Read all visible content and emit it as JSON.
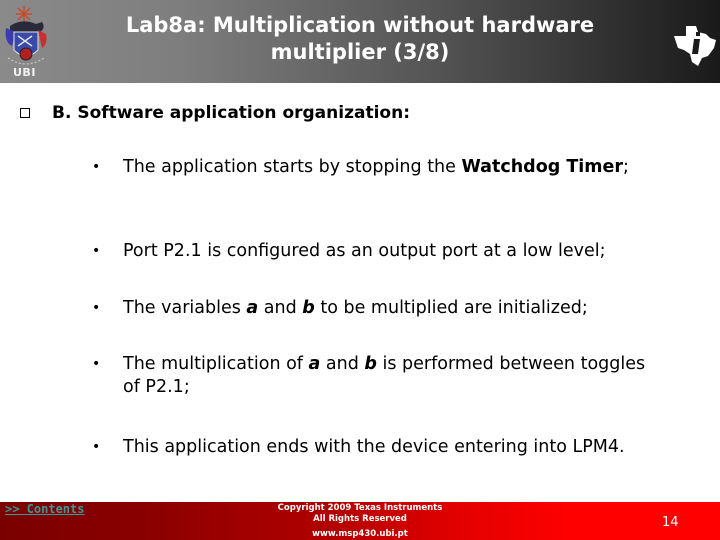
{
  "header": {
    "title_line1": "Lab8a: Multiplication without hardware",
    "title_line2": "multiplier (3/8)",
    "left_logo_text": "UBI",
    "left_logo_icon": "ubi-coat-of-arms-icon",
    "right_logo_icon": "texas-instruments-logo-icon"
  },
  "section": {
    "marker_icon": "hollow-square-bullet-icon",
    "heading": "B. Software application organization:"
  },
  "bullets": [
    {
      "parts": [
        {
          "text": "The application starts by stopping the ",
          "style": "normal"
        },
        {
          "text": "Watchdog Timer",
          "style": "bold"
        },
        {
          "text": ";",
          "style": "normal"
        }
      ]
    },
    {
      "parts": [
        {
          "text": "Port P2.1 is configured as an output port at a low level;",
          "style": "normal"
        }
      ]
    },
    {
      "parts": [
        {
          "text": "The variables ",
          "style": "normal"
        },
        {
          "text": "a",
          "style": "bold-italic"
        },
        {
          "text": " and ",
          "style": "normal"
        },
        {
          "text": "b",
          "style": "bold-italic"
        },
        {
          "text": " to be multiplied are initialized;",
          "style": "normal"
        }
      ]
    },
    {
      "parts": [
        {
          "text": "The multiplication of ",
          "style": "normal"
        },
        {
          "text": "a",
          "style": "bold-italic"
        },
        {
          "text": " and ",
          "style": "normal"
        },
        {
          "text": "b",
          "style": "bold-italic"
        },
        {
          "text": " is performed between toggles of P2.1;",
          "style": "normal"
        }
      ]
    },
    {
      "parts": [
        {
          "text": "This application ends with the device entering into LPM4.",
          "style": "normal"
        }
      ]
    }
  ],
  "footer": {
    "contents_link": ">> Contents",
    "copyright_line1": "Copyright  2009 Texas Instruments",
    "copyright_line2": "All Rights Reserved",
    "website": "www.msp430.ubi.pt",
    "page_number": "14"
  },
  "colors": {
    "footer_red": "#ff0000",
    "footer_dark_red": "#7a0000",
    "link_teal": "#3a9a9a",
    "header_gray": "#808080",
    "header_dark": "#1a1a1a"
  }
}
